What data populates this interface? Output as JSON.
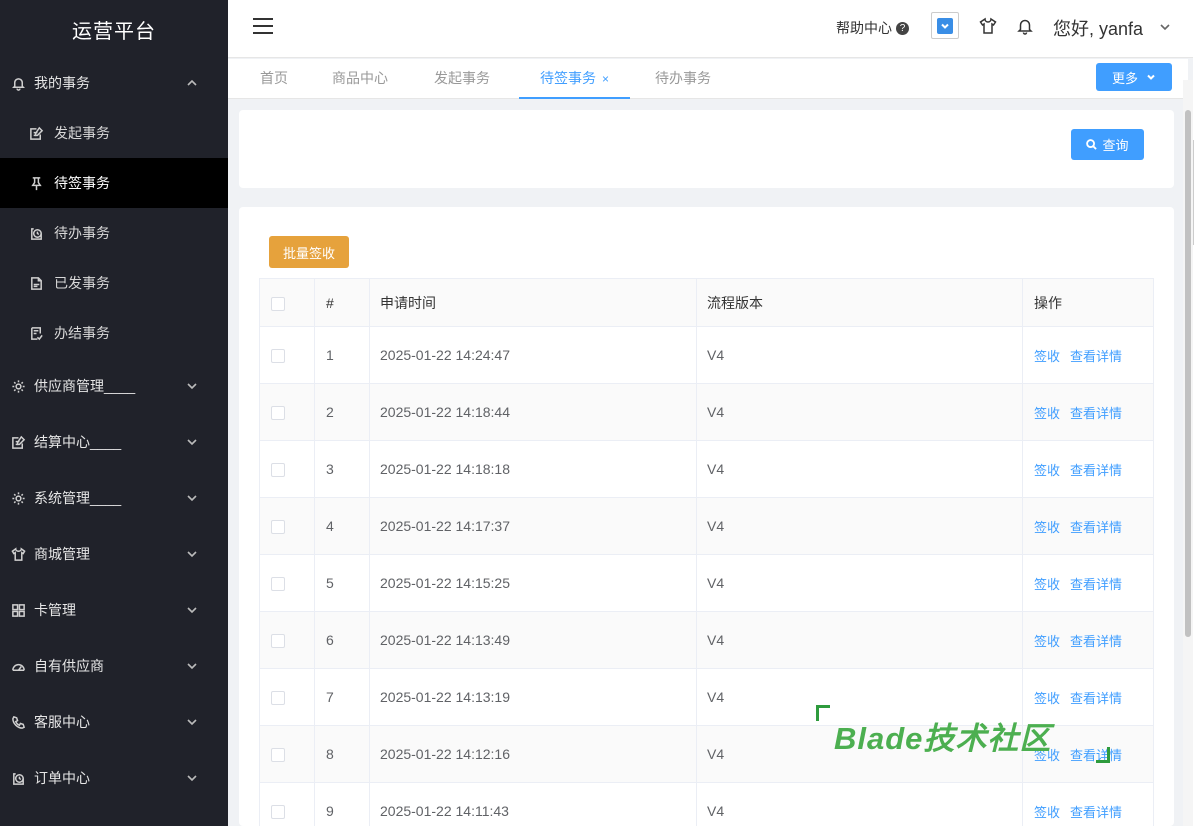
{
  "app": {
    "title": "运营平台"
  },
  "sidebar": {
    "groups": [
      {
        "label": "我的事务",
        "icon": "bell-icon",
        "expanded": true,
        "children": [
          {
            "label": "发起事务",
            "icon": "edit-icon"
          },
          {
            "label": "待签事务",
            "icon": "pin-icon",
            "active": true
          },
          {
            "label": "待办事务",
            "icon": "todo-icon"
          },
          {
            "label": "已发事务",
            "icon": "document-icon"
          },
          {
            "label": "办结事务",
            "icon": "finished-icon"
          }
        ]
      },
      {
        "label": "供应商管理____",
        "icon": "gear-icon"
      },
      {
        "label": "结算中心____",
        "icon": "edit-icon"
      },
      {
        "label": "系统管理____",
        "icon": "gear-icon"
      },
      {
        "label": "商城管理",
        "icon": "shirt-icon"
      },
      {
        "label": "卡管理",
        "icon": "grid-icon"
      },
      {
        "label": "自有供应商",
        "icon": "gauge-icon"
      },
      {
        "label": "客服中心",
        "icon": "phone-icon"
      },
      {
        "label": "订单中心",
        "icon": "order-icon"
      }
    ]
  },
  "header": {
    "help_label": "帮助中心",
    "help_icon": "question-icon",
    "greeting": "您好, yanfa"
  },
  "tabs": {
    "items": [
      {
        "label": "首页"
      },
      {
        "label": "商品中心"
      },
      {
        "label": "发起事务"
      },
      {
        "label": "待签事务",
        "active": true,
        "closable": true
      },
      {
        "label": "待办事务"
      }
    ],
    "close_glyph": "×",
    "more_label": "更多"
  },
  "search": {
    "query_label": "查询"
  },
  "toolbar": {
    "batch_sign_label": "批量签收"
  },
  "table": {
    "columns": [
      "",
      "#",
      "申请时间",
      "流程版本",
      "操作"
    ],
    "actions": {
      "sign": "签收",
      "detail": "查看详情"
    },
    "rows": [
      {
        "idx": "1",
        "time": "2025-01-22 14:24:47",
        "version": "V4"
      },
      {
        "idx": "2",
        "time": "2025-01-22 14:18:44",
        "version": "V4"
      },
      {
        "idx": "3",
        "time": "2025-01-22 14:18:18",
        "version": "V4"
      },
      {
        "idx": "4",
        "time": "2025-01-22 14:17:37",
        "version": "V4"
      },
      {
        "idx": "5",
        "time": "2025-01-22 14:15:25",
        "version": "V4"
      },
      {
        "idx": "6",
        "time": "2025-01-22 14:13:49",
        "version": "V4"
      },
      {
        "idx": "7",
        "time": "2025-01-22 14:13:19",
        "version": "V4"
      },
      {
        "idx": "8",
        "time": "2025-01-22 14:12:16",
        "version": "V4"
      },
      {
        "idx": "9",
        "time": "2025-01-22 14:11:43",
        "version": "V4"
      }
    ]
  },
  "watermark": {
    "text": "Blade技术社区"
  },
  "colors": {
    "sidebar_bg": "#20222a",
    "primary": "#409eff",
    "warning": "#e6a23c",
    "watermark": "#4caf50"
  }
}
